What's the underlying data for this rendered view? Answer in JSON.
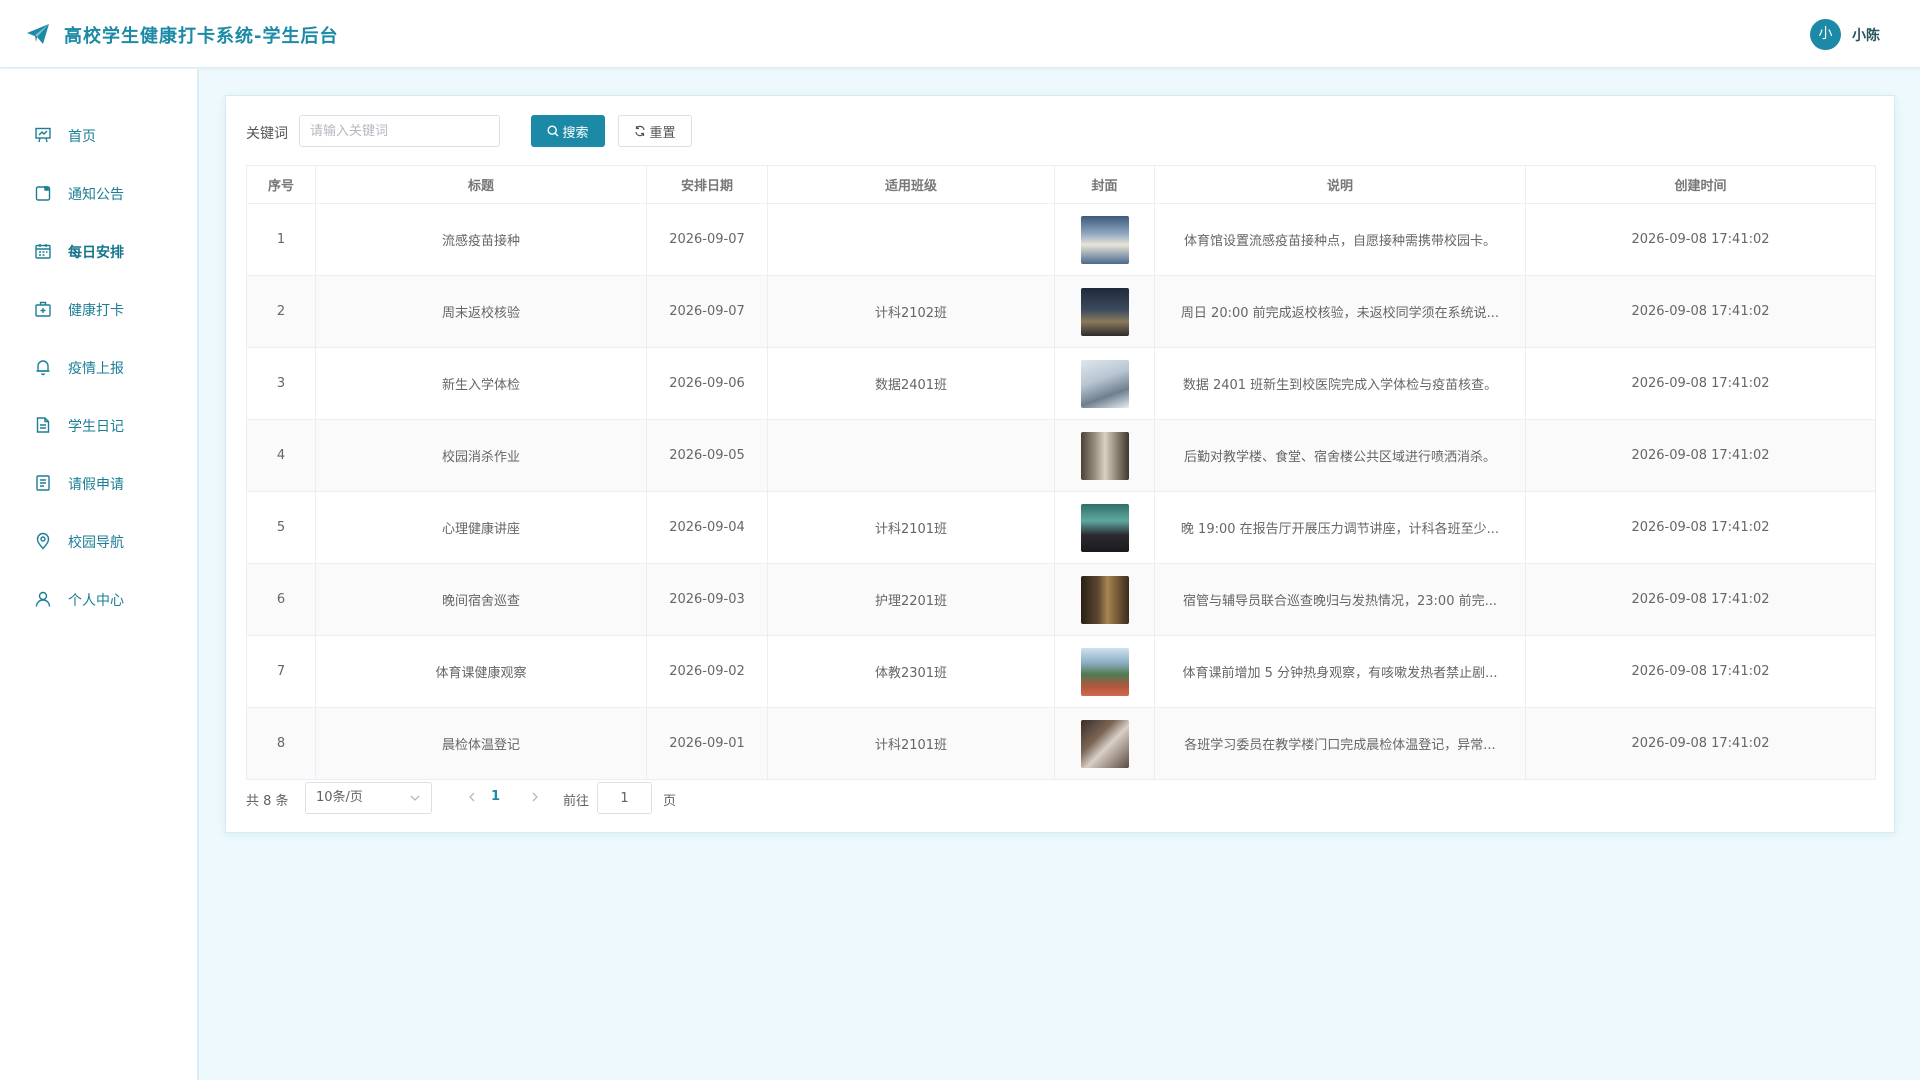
{
  "header": {
    "title": "高校学生健康打卡系统-学生后台",
    "avatar_letter": "小",
    "username": "小陈",
    "accent": "#1c8aa6"
  },
  "sidebar": {
    "items": [
      {
        "label": "首页",
        "icon": "dashboard-icon",
        "active": false
      },
      {
        "label": "通知公告",
        "icon": "notice-icon",
        "active": false
      },
      {
        "label": "每日安排",
        "icon": "calendar-icon",
        "active": true
      },
      {
        "label": "健康打卡",
        "icon": "medical-kit-icon",
        "active": false
      },
      {
        "label": "疫情上报",
        "icon": "bell-icon",
        "active": false
      },
      {
        "label": "学生日记",
        "icon": "document-icon",
        "active": false
      },
      {
        "label": "请假申请",
        "icon": "form-icon",
        "active": false
      },
      {
        "label": "校园导航",
        "icon": "location-pin-icon",
        "active": false
      },
      {
        "label": "个人中心",
        "icon": "user-icon",
        "active": false
      }
    ]
  },
  "search": {
    "label": "关键词",
    "placeholder": "请输入关键词",
    "value": "",
    "search_button": "搜索",
    "reset_button": "重置"
  },
  "table": {
    "columns": [
      "序号",
      "标题",
      "安排日期",
      "适用班级",
      "封面",
      "说明",
      "创建时间"
    ],
    "rows": [
      {
        "no": "1",
        "title": "流感疫苗接种",
        "date": "2026-09-07",
        "class": "",
        "cover": "cover-photo-vaccine",
        "desc": "体育馆设置流感疫苗接种点，自愿接种需携带校园卡。",
        "created": "2026-09-08 17:41:02"
      },
      {
        "no": "2",
        "title": "周末返校核验",
        "date": "2026-09-07",
        "class": "计科2102班",
        "cover": "cover-photo-campus-night",
        "desc": "周日 20:00 前完成返校核验，未返校同学须在系统说...",
        "created": "2026-09-08 17:41:02"
      },
      {
        "no": "3",
        "title": "新生入学体检",
        "date": "2026-09-06",
        "class": "数据2401班",
        "cover": "cover-photo-checkup",
        "desc": "数据 2401 班新生到校医院完成入学体检与疫苗核查。",
        "created": "2026-09-08 17:41:02"
      },
      {
        "no": "4",
        "title": "校园消杀作业",
        "date": "2026-09-05",
        "class": "",
        "cover": "cover-photo-corridor",
        "desc": "后勤对教学楼、食堂、宿舍楼公共区域进行喷洒消杀。",
        "created": "2026-09-08 17:41:02"
      },
      {
        "no": "5",
        "title": "心理健康讲座",
        "date": "2026-09-04",
        "class": "计科2101班",
        "cover": "cover-photo-lecture",
        "desc": "晚 19:00 在报告厅开展压力调节讲座，计科各班至少...",
        "created": "2026-09-08 17:41:02"
      },
      {
        "no": "6",
        "title": "晚间宿舍巡查",
        "date": "2026-09-03",
        "class": "护理2201班",
        "cover": "cover-photo-dorm",
        "desc": "宿管与辅导员联合巡查晚归与发热情况，23:00 前完...",
        "created": "2026-09-08 17:41:02"
      },
      {
        "no": "7",
        "title": "体育课健康观察",
        "date": "2026-09-02",
        "class": "体教2301班",
        "cover": "cover-photo-track",
        "desc": "体育课前增加 5 分钟热身观察，有咳嗽发热者禁止剧...",
        "created": "2026-09-08 17:41:02"
      },
      {
        "no": "8",
        "title": "晨检体温登记",
        "date": "2026-09-01",
        "class": "计科2101班",
        "cover": "cover-photo-temperature",
        "desc": "各班学习委员在教学楼门口完成晨检体温登记，异常...",
        "created": "2026-09-08 17:41:02"
      }
    ]
  },
  "pagination": {
    "total_text": "共 8 条",
    "page_size": "10条/页",
    "current_page": "1",
    "goto_label": "前往",
    "goto_value": "1",
    "page_unit": "页"
  }
}
